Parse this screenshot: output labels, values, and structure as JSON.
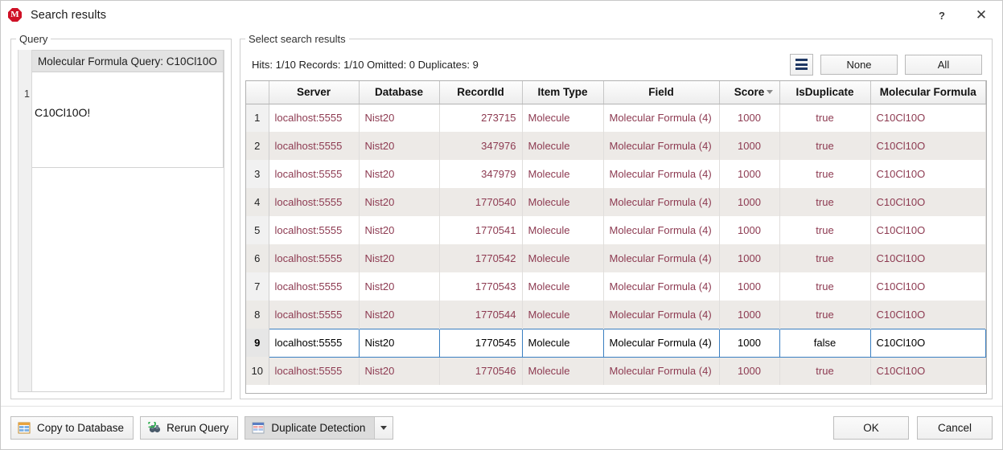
{
  "window": {
    "title": "Search results",
    "app_icon": "app-logo-icon",
    "help_label": "?",
    "close_label": "✕"
  },
  "query_panel": {
    "legend": "Query",
    "row_number": "1",
    "card_title": "Molecular Formula Query: C10Cl10O",
    "query_text": "C10Cl10O!"
  },
  "results_panel": {
    "legend": "Select search results",
    "stats": "Hits: 1/10 Records: 1/10  Omitted: 0  Duplicates: 9",
    "menu_button": "list-menu-icon",
    "none_label": "None",
    "all_label": "All",
    "sorted_column": "Score",
    "sort_direction": "descending",
    "columns": [
      {
        "key": "num",
        "label": "",
        "align": "center"
      },
      {
        "key": "server",
        "label": "Server",
        "align": "left"
      },
      {
        "key": "database",
        "label": "Database",
        "align": "left"
      },
      {
        "key": "recordid",
        "label": "RecordId",
        "align": "right"
      },
      {
        "key": "itemtype",
        "label": "Item Type",
        "align": "left"
      },
      {
        "key": "field",
        "label": "Field",
        "align": "left"
      },
      {
        "key": "score",
        "label": "Score",
        "align": "center"
      },
      {
        "key": "isdup",
        "label": "IsDuplicate",
        "align": "center"
      },
      {
        "key": "formula",
        "label": "Molecular Formula",
        "align": "left"
      }
    ],
    "rows": [
      {
        "num": "1",
        "server": "localhost:5555",
        "database": "Nist20",
        "recordid": "273715",
        "itemtype": "Molecule",
        "field": "Molecular Formula (4)",
        "score": "1000",
        "isdup": "true",
        "formula": "C10Cl10O",
        "selected": false
      },
      {
        "num": "2",
        "server": "localhost:5555",
        "database": "Nist20",
        "recordid": "347976",
        "itemtype": "Molecule",
        "field": "Molecular Formula (4)",
        "score": "1000",
        "isdup": "true",
        "formula": "C10Cl10O",
        "selected": false
      },
      {
        "num": "3",
        "server": "localhost:5555",
        "database": "Nist20",
        "recordid": "347979",
        "itemtype": "Molecule",
        "field": "Molecular Formula (4)",
        "score": "1000",
        "isdup": "true",
        "formula": "C10Cl10O",
        "selected": false
      },
      {
        "num": "4",
        "server": "localhost:5555",
        "database": "Nist20",
        "recordid": "1770540",
        "itemtype": "Molecule",
        "field": "Molecular Formula (4)",
        "score": "1000",
        "isdup": "true",
        "formula": "C10Cl10O",
        "selected": false
      },
      {
        "num": "5",
        "server": "localhost:5555",
        "database": "Nist20",
        "recordid": "1770541",
        "itemtype": "Molecule",
        "field": "Molecular Formula (4)",
        "score": "1000",
        "isdup": "true",
        "formula": "C10Cl10O",
        "selected": false
      },
      {
        "num": "6",
        "server": "localhost:5555",
        "database": "Nist20",
        "recordid": "1770542",
        "itemtype": "Molecule",
        "field": "Molecular Formula (4)",
        "score": "1000",
        "isdup": "true",
        "formula": "C10Cl10O",
        "selected": false
      },
      {
        "num": "7",
        "server": "localhost:5555",
        "database": "Nist20",
        "recordid": "1770543",
        "itemtype": "Molecule",
        "field": "Molecular Formula (4)",
        "score": "1000",
        "isdup": "true",
        "formula": "C10Cl10O",
        "selected": false
      },
      {
        "num": "8",
        "server": "localhost:5555",
        "database": "Nist20",
        "recordid": "1770544",
        "itemtype": "Molecule",
        "field": "Molecular Formula (4)",
        "score": "1000",
        "isdup": "true",
        "formula": "C10Cl10O",
        "selected": false
      },
      {
        "num": "9",
        "server": "localhost:5555",
        "database": "Nist20",
        "recordid": "1770545",
        "itemtype": "Molecule",
        "field": "Molecular Formula (4)",
        "score": "1000",
        "isdup": "false",
        "formula": "C10Cl10O",
        "selected": true
      },
      {
        "num": "10",
        "server": "localhost:5555",
        "database": "Nist20",
        "recordid": "1770546",
        "itemtype": "Molecule",
        "field": "Molecular Formula (4)",
        "score": "1000",
        "isdup": "true",
        "formula": "C10Cl10O",
        "selected": false
      }
    ]
  },
  "footer": {
    "copy_to_database": "Copy to Database",
    "rerun_query": "Rerun Query",
    "duplicate_detection": "Duplicate Detection",
    "duplicate_detection_pressed": true,
    "ok_label": "OK",
    "cancel_label": "Cancel"
  },
  "colors": {
    "accent_selection": "#3a7fc1",
    "cell_text": "#8d3a51",
    "logo": "#cf1126",
    "icon_navy": "#1f3864"
  }
}
